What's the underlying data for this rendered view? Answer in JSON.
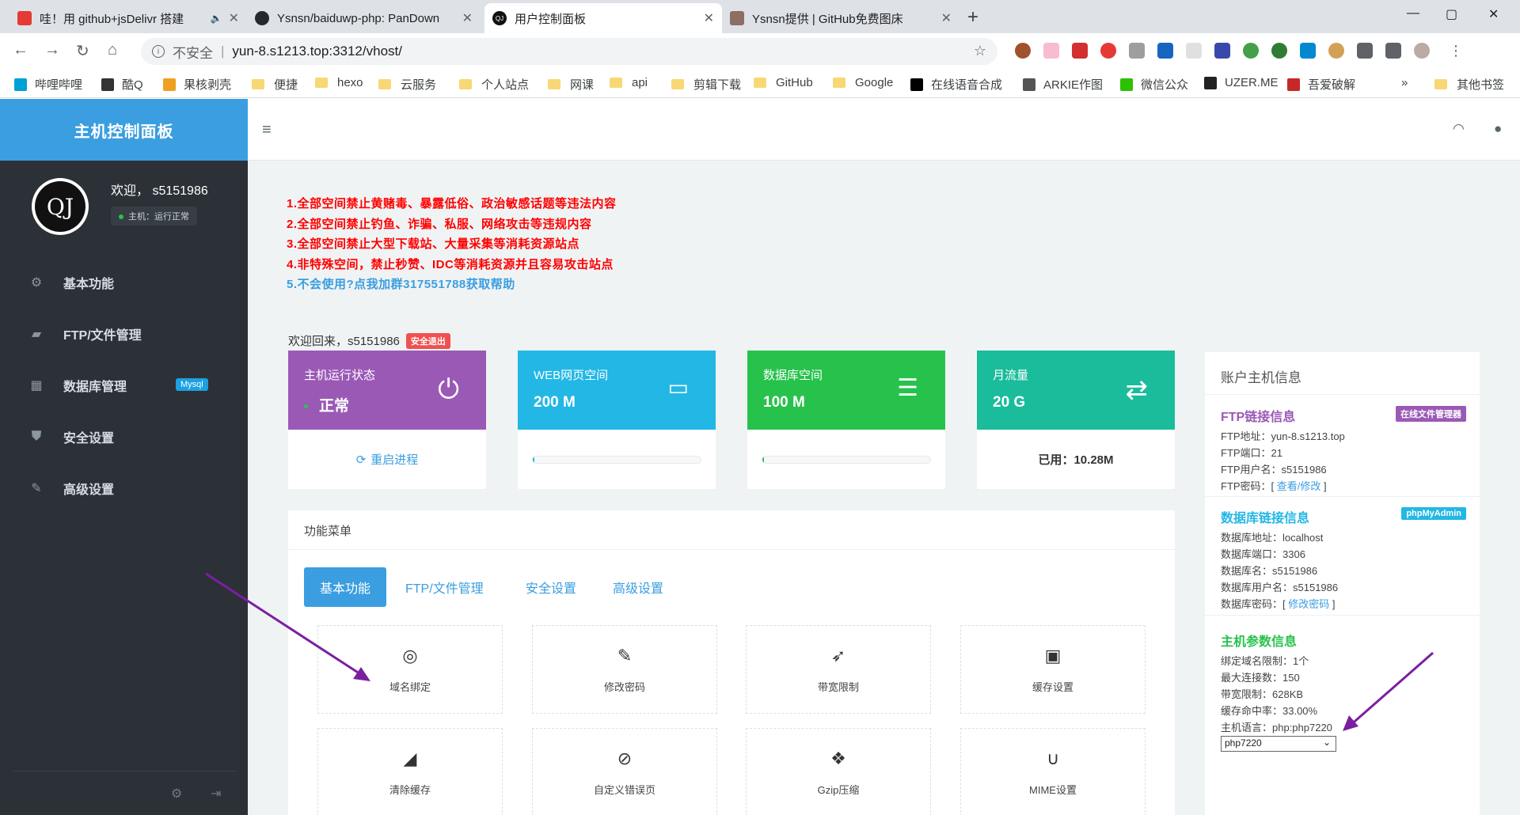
{
  "browser": {
    "tabs": [
      {
        "title": "哇！用 github+jsDelivr 搭建",
        "favicon_color": "#e53935",
        "sound": "🔈"
      },
      {
        "title": "Ysnsn/baiduwp-php: PanDown",
        "favicon_color": "#24292e"
      },
      {
        "title": "用户控制面板",
        "favicon_color": "#111111",
        "favicon_text": "QJ"
      },
      {
        "title": "Ysnsn提供 | GitHub免费图床",
        "favicon_color": "#8d6e63"
      }
    ],
    "close_glyph": "✕",
    "new_tab_glyph": "+",
    "window_controls": [
      "—",
      "▢",
      "✕"
    ],
    "nav": {
      "back": "←",
      "forward": "→",
      "reload": "↻",
      "home": "⌂"
    },
    "insecure_label": "不安全",
    "separator": "|",
    "url": "yun-8.s1213.top:3312/vhost/",
    "bookmarks": [
      {
        "label": "哔哩哔哩",
        "icon_color": "#00a1d6",
        "type": "site"
      },
      {
        "label": "酷Q",
        "icon_color": "#333333",
        "type": "site"
      },
      {
        "label": "果核剥壳",
        "icon_color": "#f0a020",
        "type": "site"
      },
      {
        "label": "便捷",
        "type": "folder"
      },
      {
        "label": "hexo",
        "type": "folder"
      },
      {
        "label": "云服务",
        "type": "folder"
      },
      {
        "label": "个人站点",
        "type": "folder"
      },
      {
        "label": "网课",
        "type": "folder"
      },
      {
        "label": "api",
        "type": "folder"
      },
      {
        "label": "剪辑下载",
        "type": "folder"
      },
      {
        "label": "GitHub",
        "type": "folder"
      },
      {
        "label": "Google",
        "type": "folder"
      },
      {
        "label": "在线语音合成",
        "icon_color": "#000000",
        "type": "site"
      },
      {
        "label": "ARKIE作图",
        "icon_color": "#555555",
        "type": "site"
      },
      {
        "label": "微信公众",
        "icon_color": "#2dc100",
        "type": "site"
      },
      {
        "label": "UZER.ME",
        "icon_color": "#222222",
        "type": "site"
      },
      {
        "label": "吾爱破解",
        "icon_color": "#c62828",
        "type": "site"
      }
    ],
    "more": "»",
    "other_bookmarks": "其他书签"
  },
  "sidebar": {
    "brand": "主机控制面板",
    "avatar_text": "QJ",
    "welcome": "欢迎， s5151986",
    "host_status": "主机：运行正常",
    "items": [
      {
        "label": "基本功能",
        "icon": "gears-icon",
        "glyph": "⚙"
      },
      {
        "label": "FTP/文件管理",
        "icon": "folder-open-icon",
        "glyph": "📂"
      },
      {
        "label": "数据库管理",
        "icon": "table-icon",
        "glyph": "▦",
        "badge": "Mysql"
      },
      {
        "label": "安全设置",
        "icon": "shield-icon",
        "glyph": "⛊"
      },
      {
        "label": "高级设置",
        "icon": "edit-icon",
        "glyph": "✎"
      }
    ],
    "footer_icons": [
      "⚙",
      "⇥"
    ]
  },
  "topbar": {
    "menu_glyph": "≡",
    "headset_glyph": "🎧",
    "user_glyph": "👤"
  },
  "notices": [
    "1.全部空间禁止黄赌毒、暴露低俗、政治敏感话题等违法内容",
    "2.全部空间禁止钓鱼、诈骗、私服、网络攻击等违规内容",
    "3.全部空间禁止大型下载站、大量采集等消耗资源站点",
    "4.非特殊空间，禁止秒赞、IDC等消耗资源并且容易攻击站点",
    "5.不会使用?点我加群317551788获取帮助"
  ],
  "welcome_back": {
    "text": "欢迎回来，s5151986",
    "logout": "安全退出"
  },
  "cards": [
    {
      "label": "主机运行状态",
      "value": "正常",
      "color": "#9b59b6",
      "icon": "power-icon",
      "glyph": "⏻",
      "footer": "重启进程",
      "footer_glyph": "⟳"
    },
    {
      "label": "WEB网页空间",
      "value": "200 M",
      "color": "#23b7e5",
      "icon": "hdd-icon",
      "glyph": "🖴",
      "progress": 0.01,
      "bar_color": "#23b7e5"
    },
    {
      "label": "数据库空间",
      "value": "100 M",
      "color": "#27c24c",
      "icon": "database-icon",
      "glyph": "🛢",
      "progress": 0.01,
      "bar_color": "#27c24c"
    },
    {
      "label": "月流量",
      "value": "20 G",
      "color": "#1abc9c",
      "icon": "exchange-icon",
      "glyph": "⇄",
      "footer": "已用：10.28M"
    }
  ],
  "menu": {
    "title": "功能菜单",
    "tabs": [
      "基本功能",
      "FTP/文件管理",
      "安全设置",
      "高级设置"
    ],
    "tiles": [
      {
        "label": "域名绑定",
        "icon": "dribbble-icon",
        "glyph": "◎"
      },
      {
        "label": "修改密码",
        "icon": "wrench-icon",
        "glyph": "🔧"
      },
      {
        "label": "带宽限制",
        "icon": "rocket-icon",
        "glyph": "🚀"
      },
      {
        "label": "缓存设置",
        "icon": "floppy-icon",
        "glyph": "💾"
      },
      {
        "label": "清除缓存",
        "icon": "eraser-icon",
        "glyph": "⌫"
      },
      {
        "label": "自定义错误页",
        "icon": "paperclip-icon",
        "glyph": "📎"
      },
      {
        "label": "Gzip压缩",
        "icon": "dropbox-icon",
        "glyph": "❖"
      },
      {
        "label": "MIME设置",
        "icon": "magnet-icon",
        "glyph": "∪"
      }
    ]
  },
  "account": {
    "title": "账户主机信息",
    "ftp": {
      "title": "FTP链接信息",
      "tag": "在线文件管理器",
      "rows": [
        "FTP地址：yun-8.s1213.top",
        "FTP端口：21",
        "FTP用户名：s5151986"
      ],
      "pwd_prefix": "FTP密码：[ ",
      "pwd_link": "查看/修改",
      "pwd_suffix": " ]"
    },
    "db": {
      "title": "数据库链接信息",
      "tag": "phpMyAdmin",
      "rows": [
        "数据库地址：localhost",
        "数据库端口：3306",
        "数据库名：s5151986",
        "数据库用户名：s5151986"
      ],
      "pwd_prefix": "数据库密码：[ ",
      "pwd_link": "修改密码",
      "pwd_suffix": " ]"
    },
    "host": {
      "title": "主机参数信息",
      "rows": [
        "绑定域名限制：1个",
        "最大连接数：150",
        "带宽限制：628KB",
        "缓存命中率：33.00%",
        "主机语言：php:php7220"
      ],
      "select_value": "php7220"
    }
  }
}
